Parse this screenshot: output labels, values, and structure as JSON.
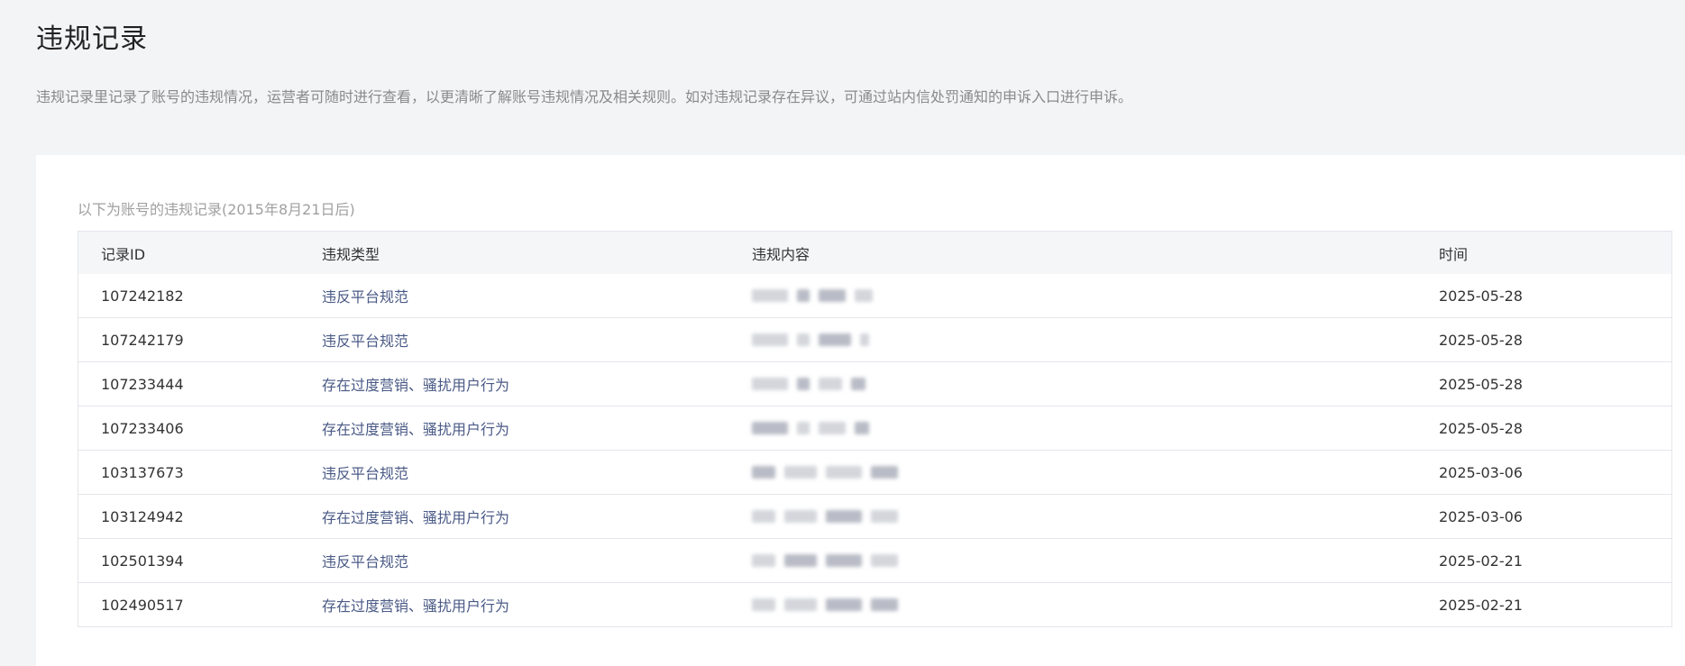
{
  "page": {
    "title": "违规记录",
    "description": "违规记录里记录了账号的违规情况，运营者可随时进行查看，以更清晰了解账号违规情况及相关规则。如对违规记录存在异议，可通过站内信处罚通知的申诉入口进行申诉。"
  },
  "card": {
    "caption": "以下为账号的违规记录(2015年8月21日后)"
  },
  "table": {
    "headers": {
      "id": "记录ID",
      "type": "违规类型",
      "content": "违规内容",
      "time": "时间"
    },
    "rows": [
      {
        "id": "107242182",
        "type": "违反平台规范",
        "time": "2025-05-28"
      },
      {
        "id": "107242179",
        "type": "违反平台规范",
        "time": "2025-05-28"
      },
      {
        "id": "107233444",
        "type": "存在过度营销、骚扰用户行为",
        "time": "2025-05-28"
      },
      {
        "id": "107233406",
        "type": "存在过度营销、骚扰用户行为",
        "time": "2025-05-28"
      },
      {
        "id": "103137673",
        "type": "违反平台规范",
        "time": "2025-03-06"
      },
      {
        "id": "103124942",
        "type": "存在过度营销、骚扰用户行为",
        "time": "2025-03-06"
      },
      {
        "id": "102501394",
        "type": "违反平台规范",
        "time": "2025-02-21"
      },
      {
        "id": "102490517",
        "type": "存在过度营销、骚扰用户行为",
        "time": "2025-02-21"
      }
    ]
  },
  "colors": {
    "background": "#f3f4f6",
    "card": "#ffffff",
    "link": "#4a5a86",
    "header_bg": "#f5f6f8",
    "border": "#e4e6eb"
  }
}
